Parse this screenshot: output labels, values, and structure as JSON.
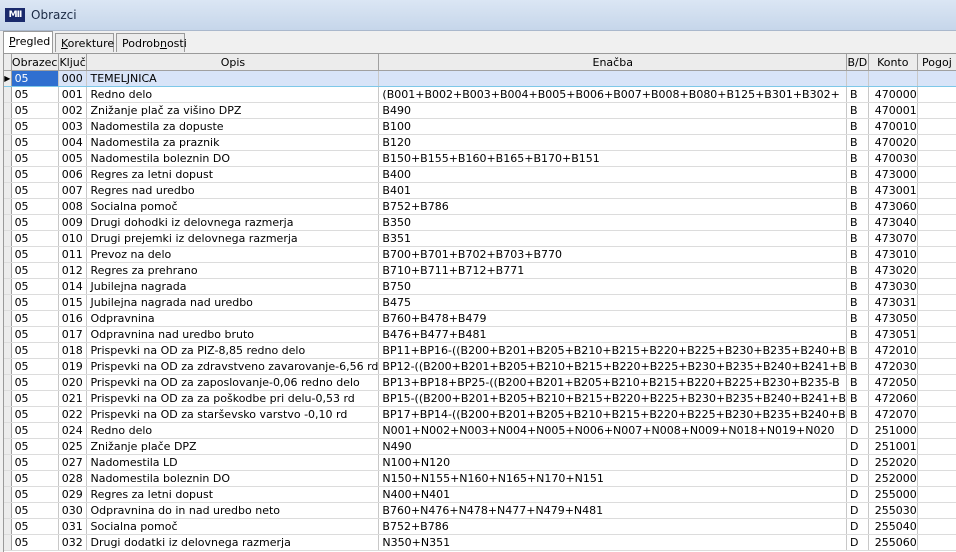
{
  "window": {
    "title": "Obrazci",
    "logo": "MII"
  },
  "tabs": [
    {
      "label": "Pregled",
      "ul": "P",
      "rest": "regled",
      "active": true
    },
    {
      "label": "Korekture",
      "ul": "K",
      "rest": "orekture",
      "active": false
    },
    {
      "label": "Podrobnosti",
      "pre": "Podrob",
      "ul": "n",
      "rest": "osti",
      "active": false
    }
  ],
  "columns": [
    "Obrazec",
    "Ključ",
    "Opis",
    "Enačba",
    "B/D",
    "Konto",
    "Pogoj"
  ],
  "selected_row_indicator": "▶",
  "rows": [
    [
      "05",
      "000",
      "TEMELJNICA",
      "",
      "",
      "",
      ""
    ],
    [
      "05",
      "001",
      "Redno delo",
      "(B001+B002+B003+B004+B005+B006+B007+B008+B080+B125+B301+B302+",
      "B",
      "470000",
      ""
    ],
    [
      "05",
      "002",
      "Znižanje  plač za višino DPZ",
      "B490",
      "B",
      "470001",
      ""
    ],
    [
      "05",
      "003",
      "Nadomestila za dopuste",
      "B100",
      "B",
      "470010",
      ""
    ],
    [
      "05",
      "004",
      "Nadomestila za praznik",
      "B120",
      "B",
      "470020",
      ""
    ],
    [
      "05",
      "005",
      "Nadomestila boleznin DO",
      "B150+B155+B160+B165+B170+B151",
      "B",
      "470030",
      ""
    ],
    [
      "05",
      "006",
      "Regres za letni dopust",
      "B400",
      "B",
      "473000",
      ""
    ],
    [
      "05",
      "007",
      "Regres nad uredbo",
      "B401",
      "B",
      "473001",
      ""
    ],
    [
      "05",
      "008",
      "Socialna pomoč",
      "B752+B786",
      "B",
      "473060",
      ""
    ],
    [
      "05",
      "009",
      "Drugi dohodki iz delovnega razmerja",
      "B350",
      "B",
      "473040",
      ""
    ],
    [
      "05",
      "010",
      "Drugi prejemki iz delovnega razmerja",
      "B351",
      "B",
      "473070",
      ""
    ],
    [
      "05",
      "011",
      "Prevoz na delo",
      "B700+B701+B702+B703+B770",
      "B",
      "473010",
      ""
    ],
    [
      "05",
      "012",
      "Regres za prehrano",
      "B710+B711+B712+B771",
      "B",
      "473020",
      ""
    ],
    [
      "05",
      "014",
      "Jubilejna nagrada",
      "B750",
      "B",
      "473030",
      ""
    ],
    [
      "05",
      "015",
      "Jubilejna nagrada  nad uredbo",
      "B475",
      "B",
      "473031",
      ""
    ],
    [
      "05",
      "016",
      "Odpravnina",
      "B760+B478+B479",
      "B",
      "473050",
      ""
    ],
    [
      "05",
      "017",
      "Odpravnina nad uredbo bruto",
      "B476+B477+B481",
      "B",
      "473051",
      ""
    ],
    [
      "05",
      "018",
      "Prispevki na OD za  PIZ-8,85 redno delo",
      "BP11+BP16-((B200+B201+B205+B210+B215+B220+B225+B230+B235+B240+B",
      "B",
      "472010",
      ""
    ],
    [
      "05",
      "019",
      "Prispevki na OD za zdravstveno zavarovanje-6,56 rd",
      "BP12-((B200+B201+B205+B210+B215+B220+B225+B230+B235+B240+B241+B",
      "B",
      "472030",
      ""
    ],
    [
      "05",
      "020",
      "Prispevki na OD za zaposlovanje-0,06 redno delo",
      "BP13+BP18+BP25-((B200+B201+B205+B210+B215+B220+B225+B230+B235-B",
      "B",
      "472050",
      ""
    ],
    [
      "05",
      "021",
      "Prispevki na OD za za poškodbe pri delu-0,53 rd",
      "BP15-((B200+B201+B205+B210+B215+B220+B225+B230+B235+B240+B241+B",
      "B",
      "472060",
      ""
    ],
    [
      "05",
      "022",
      "Prispevki na OD za starševsko varstvo -0,10 rd",
      "BP17+BP14-((B200+B201+B205+B210+B215+B220+B225+B230+B235+B240+B",
      "B",
      "472070",
      ""
    ],
    [
      "05",
      "024",
      "Redno delo",
      "N001+N002+N003+N004+N005+N006+N007+N008+N009+N018+N019+N020",
      "D",
      "251000",
      ""
    ],
    [
      "05",
      "025",
      "Znižanje plače DPZ",
      "N490",
      "D",
      "251001",
      ""
    ],
    [
      "05",
      "027",
      "Nadomestila LD",
      "N100+N120",
      "D",
      "252020",
      ""
    ],
    [
      "05",
      "028",
      "Nadomestila boleznin DO",
      "N150+N155+N160+N165+N170+N151",
      "D",
      "252000",
      ""
    ],
    [
      "05",
      "029",
      "Regres za letni dopust",
      "N400+N401",
      "D",
      "255000",
      ""
    ],
    [
      "05",
      "030",
      "Odpravnina do in nad uredbo  neto",
      "B760+N476+N478+N477+N479+N481",
      "D",
      "255030",
      ""
    ],
    [
      "05",
      "031",
      "Socialna pomoč",
      "B752+B786",
      "D",
      "255040",
      ""
    ],
    [
      "05",
      "032",
      "Drugi dodatki iz delovnega razmerja",
      "N350+N351",
      "D",
      "255060",
      ""
    ]
  ],
  "colors": {
    "selection": "#d8e4f8",
    "selected_cell": "#2f6fd0",
    "title_bar": "#c6d6ea"
  }
}
